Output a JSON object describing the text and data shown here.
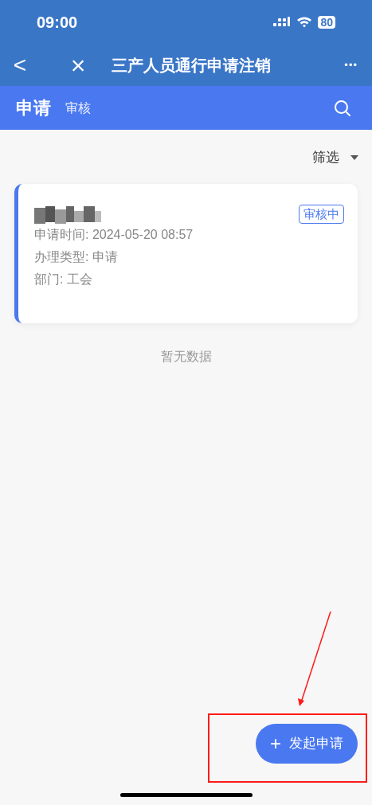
{
  "status_bar": {
    "time": "09:00",
    "battery": "80"
  },
  "nav_bar": {
    "back": "<",
    "close": "×",
    "title": "三产人员通行申请注销",
    "more": "•••"
  },
  "tabs": [
    {
      "label": "申请",
      "selected": true
    },
    {
      "label": "审核",
      "selected": false
    }
  ],
  "filter": {
    "label": "筛选"
  },
  "records": [
    {
      "status": "审核中",
      "fields": [
        "申请时间: 2024-05-20 08:57",
        "办理类型: 申请",
        "部门: 工会"
      ]
    }
  ],
  "empty_text": "暂无数据",
  "fab": {
    "icon": "+",
    "label": "发起申请"
  }
}
